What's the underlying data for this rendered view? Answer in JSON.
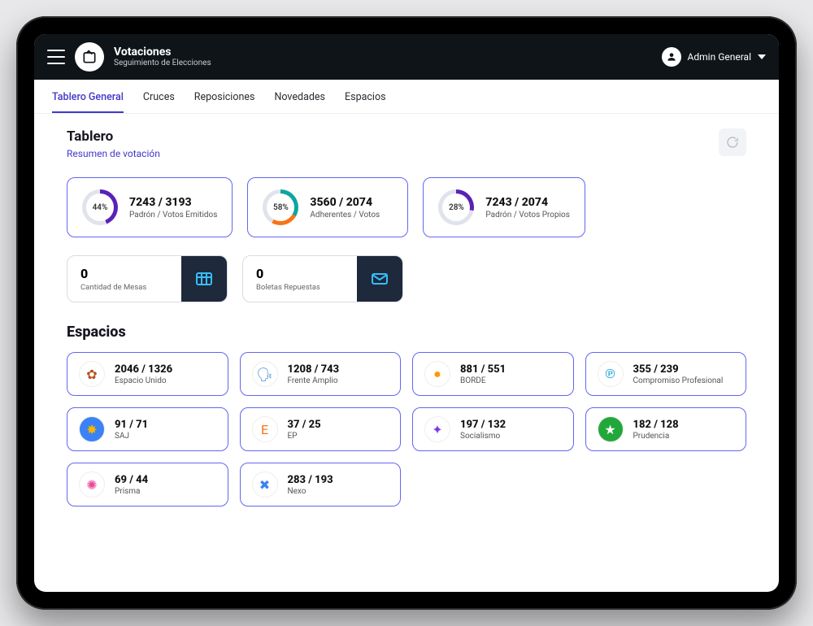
{
  "header": {
    "title": "Votaciones",
    "subtitle": "Seguimiento de Elecciones",
    "user_name": "Admin General"
  },
  "tabs": [
    {
      "label": "Tablero General",
      "active": true
    },
    {
      "label": "Cruces",
      "active": false
    },
    {
      "label": "Reposiciones",
      "active": false
    },
    {
      "label": "Novedades",
      "active": false
    },
    {
      "label": "Espacios",
      "active": false
    }
  ],
  "dashboard": {
    "heading": "Tablero",
    "subheading": "Resumen de votación",
    "stats": [
      {
        "percent": "44%",
        "value": "7243 / 3193",
        "label": "Padrón / Votos Emitidos",
        "ring_bg": "conic-gradient(#5b21b6 0 158deg, #e0e3eb 158deg 360deg)"
      },
      {
        "percent": "58%",
        "value": "3560 / 2074",
        "label": "Adherentes / Votos",
        "ring_bg": "conic-gradient(#0ea5a0 0 120deg, #f97316 120deg 209deg, #e0e3eb 209deg 360deg)"
      },
      {
        "percent": "28%",
        "value": "7243 / 2074",
        "label": "Padrón / Votos Propios",
        "ring_bg": "conic-gradient(#5b21b6 0 101deg, #e0e3eb 101deg 360deg)"
      }
    ],
    "counters": [
      {
        "value": "0",
        "label": "Cantidad de Mesas",
        "icon": "table-grid-icon"
      },
      {
        "value": "0",
        "label": "Boletas Repuestas",
        "icon": "envelope-icon"
      }
    ]
  },
  "espacios": {
    "heading": "Espacios",
    "items": [
      {
        "value": "2046 / 1326",
        "label": "Espacio Unido",
        "logo_bg": "#fff",
        "logo_color": "#b4531d",
        "glyph": "✿"
      },
      {
        "value": "1208 / 743",
        "label": "Frente Amplio",
        "logo_bg": "#fff",
        "logo_color": "#1976d2",
        "glyph": "🗣"
      },
      {
        "value": "881 / 551",
        "label": "BORDE",
        "logo_bg": "#fff",
        "logo_color": "#ff9800",
        "glyph": "●"
      },
      {
        "value": "355 / 239",
        "label": "Compromiso Profesional",
        "logo_bg": "#fff",
        "logo_color": "#0097d6",
        "glyph": "℗"
      },
      {
        "value": "91 / 71",
        "label": "SAJ",
        "logo_bg": "#3b82f6",
        "logo_color": "#ffb300",
        "glyph": "✸"
      },
      {
        "value": "37 / 25",
        "label": "EP",
        "logo_bg": "#fff",
        "logo_color": "#f97316",
        "glyph": "E"
      },
      {
        "value": "197 / 132",
        "label": "Socialismo",
        "logo_bg": "#fff",
        "logo_color": "#7c3aed",
        "glyph": "✦"
      },
      {
        "value": "182 / 128",
        "label": "Prudencia",
        "logo_bg": "#22a83a",
        "logo_color": "#fff",
        "glyph": "★"
      },
      {
        "value": "69 / 44",
        "label": "Prisma",
        "logo_bg": "#fff",
        "logo_color": "#ec4899",
        "glyph": "✺"
      },
      {
        "value": "283 / 193",
        "label": "Nexo",
        "logo_bg": "#fff",
        "logo_color": "#3b82f6",
        "glyph": "✖"
      }
    ]
  }
}
